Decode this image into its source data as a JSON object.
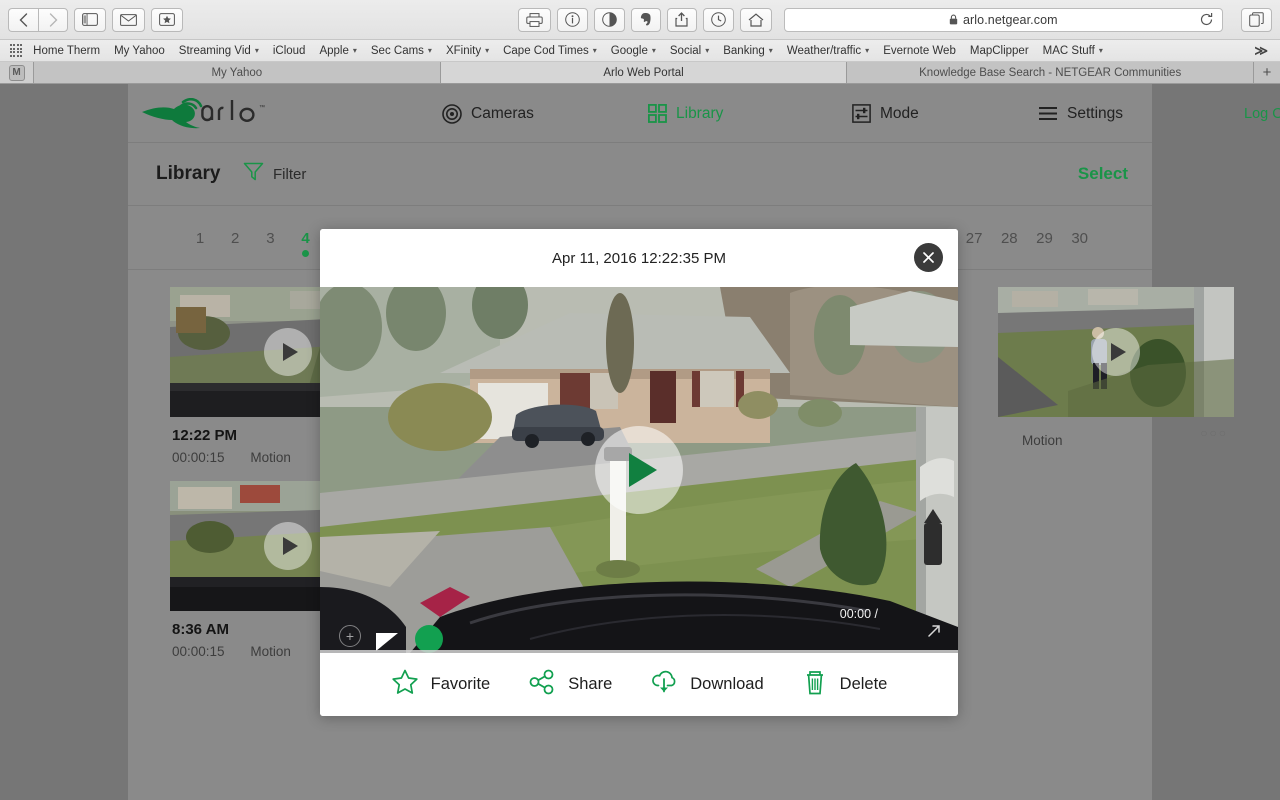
{
  "browser": {
    "url": "arlo.netgear.com",
    "toolbar_buttons": [
      {
        "name": "back",
        "icon": "chevron-left-icon"
      },
      {
        "name": "forward",
        "icon": "chevron-right-icon"
      },
      {
        "name": "sidebar",
        "icon": "sidebar-icon"
      },
      {
        "name": "mail",
        "icon": "envelope-icon"
      },
      {
        "name": "bookmark",
        "icon": "star-box-icon"
      },
      {
        "name": "print",
        "icon": "printer-icon"
      },
      {
        "name": "info",
        "icon": "info-circle-icon"
      },
      {
        "name": "reader",
        "icon": "adblock-icon"
      },
      {
        "name": "evernote",
        "icon": "elephant-icon"
      },
      {
        "name": "share",
        "icon": "share-up-icon"
      },
      {
        "name": "history",
        "icon": "clock-icon"
      },
      {
        "name": "home",
        "icon": "home-icon"
      },
      {
        "name": "tabs",
        "icon": "duplicate-icon"
      }
    ],
    "bookmarks": [
      {
        "label": "Home Therm",
        "dropdown": false
      },
      {
        "label": "My Yahoo",
        "dropdown": false
      },
      {
        "label": "Streaming Vid",
        "dropdown": true
      },
      {
        "label": "iCloud",
        "dropdown": false
      },
      {
        "label": "Apple",
        "dropdown": true
      },
      {
        "label": "Sec Cams",
        "dropdown": true
      },
      {
        "label": "XFinity",
        "dropdown": true
      },
      {
        "label": "Cape Cod Times",
        "dropdown": true
      },
      {
        "label": "Google",
        "dropdown": true
      },
      {
        "label": "Social",
        "dropdown": true
      },
      {
        "label": "Banking",
        "dropdown": true
      },
      {
        "label": "Weather/traffic",
        "dropdown": true
      },
      {
        "label": "Evernote Web",
        "dropdown": false
      },
      {
        "label": "MapClipper",
        "dropdown": false
      },
      {
        "label": "MAC Stuff",
        "dropdown": true
      }
    ],
    "bookmarks_overflow": "≫",
    "tabs": [
      {
        "label": "My Yahoo",
        "active": false
      },
      {
        "label": "Arlo Web Portal",
        "active": true
      },
      {
        "label": "Knowledge Base Search - NETGEAR Communities",
        "active": false
      }
    ],
    "tab_badge": "M",
    "new_tab": "+"
  },
  "app": {
    "brand": "arlo",
    "nav": [
      {
        "label": "Cameras",
        "icon": "camera-lens-icon",
        "active": false
      },
      {
        "label": "Library",
        "icon": "grid-squares-icon",
        "active": true
      },
      {
        "label": "Mode",
        "icon": "sliders-box-icon",
        "active": false
      },
      {
        "label": "Settings",
        "icon": "hamburger-icon",
        "active": false
      }
    ],
    "logout_label": "Log Out",
    "library": {
      "title": "Library",
      "filter_label": "Filter",
      "select_label": "Select",
      "dates": [
        "1",
        "2",
        "3",
        "4",
        "27",
        "28",
        "29",
        "30"
      ],
      "selected_date": "4",
      "clips": [
        {
          "time": "12:22 PM",
          "duration": "00:00:15",
          "type": "Motion"
        },
        {
          "time": "8:36 AM",
          "duration": "00:00:15",
          "type": "Motion"
        },
        {
          "time": "",
          "duration": "",
          "type": "Motion"
        }
      ]
    }
  },
  "modal": {
    "title": "Apr 11, 2016 12:22:35 PM",
    "close_icon": "close-icon",
    "play_icon": "play-icon",
    "player": {
      "current_time": "00:00 /",
      "zoom_icon": "zoom-in-icon",
      "fullscreen_icon": "fullscreen-arrow-icon"
    },
    "actions": [
      {
        "label": "Favorite",
        "icon": "star-icon"
      },
      {
        "label": "Share",
        "icon": "share-nodes-icon"
      },
      {
        "label": "Download",
        "icon": "cloud-download-icon"
      },
      {
        "label": "Delete",
        "icon": "trash-icon"
      }
    ]
  },
  "colors": {
    "accent_green": "#12a050",
    "brand_green": "#0e7a3c",
    "page_bg": "#767676",
    "app_bg": "#8a8a8a",
    "modal_bg": "#ffffff"
  }
}
